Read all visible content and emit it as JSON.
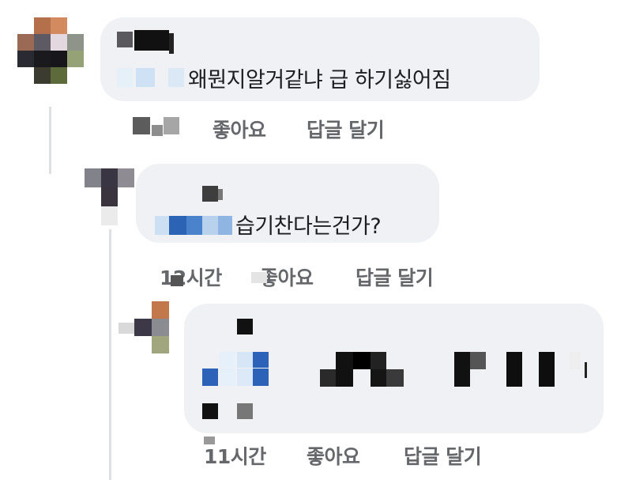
{
  "comments": [
    {
      "text": "왜뭔지알거같냐 급 하기싫어짐",
      "time": "",
      "like": "좋아요",
      "reply": "답글 달기"
    },
    {
      "text": "습기찬다는건가?",
      "time": "12시간",
      "like": "좋아요",
      "reply": "답글 달기"
    },
    {
      "text": "",
      "time": "11시간",
      "like": "좋아요",
      "reply": "답글 달기"
    }
  ],
  "colors": {
    "bubble": "#eff1f4",
    "action_text": "#65676b",
    "thread_line": "#dddfe2"
  }
}
